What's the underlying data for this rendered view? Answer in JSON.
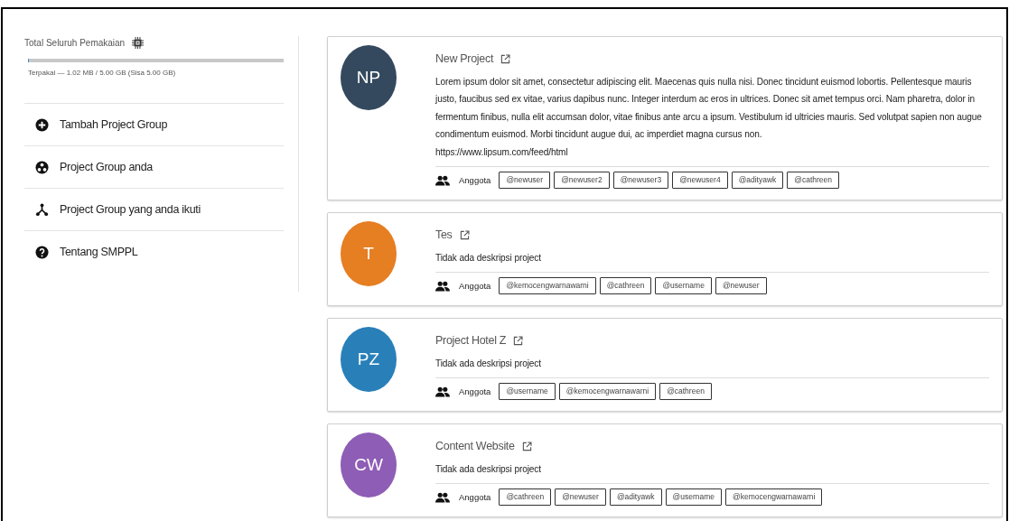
{
  "usage": {
    "title": "Total Seluruh Pemakaian",
    "level": 0.004,
    "reading": "Terpakai — 1.02 MB / 5.00 GB (Sisa 5.00 GB)"
  },
  "menu": [
    {
      "kind": "add",
      "label": "Tambah Project Group"
    },
    {
      "kind": "own",
      "label": "Project Group anda"
    },
    {
      "kind": "joined",
      "label": "Project Group yang anda ikuti"
    },
    {
      "kind": "about",
      "label": "Tentang SMPPL"
    }
  ],
  "projects": [
    {
      "initials": "NP",
      "color": "#34495e",
      "title": "New Project",
      "description": "Lorem ipsum dolor sit amet, consectetur adipiscing elit. Maecenas quis nulla nisi. Donec tincidunt euismod lobortis. Pellentesque mauris justo, faucibus sed ex vitae, varius dapibus nunc. Integer interdum ac eros in ultrices. Donec sit amet tempus orci. Nam pharetra, dolor in fermentum finibus, nulla elit accumsan dolor, vitae finibus ante arcu a ipsum. Vestibulum id ultricies mauris. Sed volutpat sapien non augue condimentum euismod. Morbi tincidunt augue dui, ac imperdiet magna cursus non.",
      "url": "https://www.lipsum.com/feed/html",
      "members_label": "Anggota",
      "members": [
        "@newuser",
        "@newuser2",
        "@newuser3",
        "@newuser4",
        "@adityawk",
        "@cathreen"
      ]
    },
    {
      "initials": "T",
      "color": "#e67e22",
      "title": "Tes",
      "description": "Tidak ada deskripsi project",
      "members_label": "Anggota",
      "members": [
        "@kemocengwarnawarni",
        "@cathreen",
        "@username",
        "@newuser"
      ]
    },
    {
      "initials": "PZ",
      "color": "#2980b9",
      "title": "Project Hotel Z",
      "description": "Tidak ada deskripsi project",
      "members_label": "Anggota",
      "members": [
        "@username",
        "@kemocengwarnawarni",
        "@cathreen"
      ]
    },
    {
      "initials": "CW",
      "color": "#8e5db5",
      "title": "Content Website",
      "description": "Tidak ada deskripsi project",
      "members_label": "Anggota",
      "members": [
        "@cathreen",
        "@newuser",
        "@adityawk",
        "@username",
        "@kemocengwarnawarni"
      ]
    }
  ]
}
